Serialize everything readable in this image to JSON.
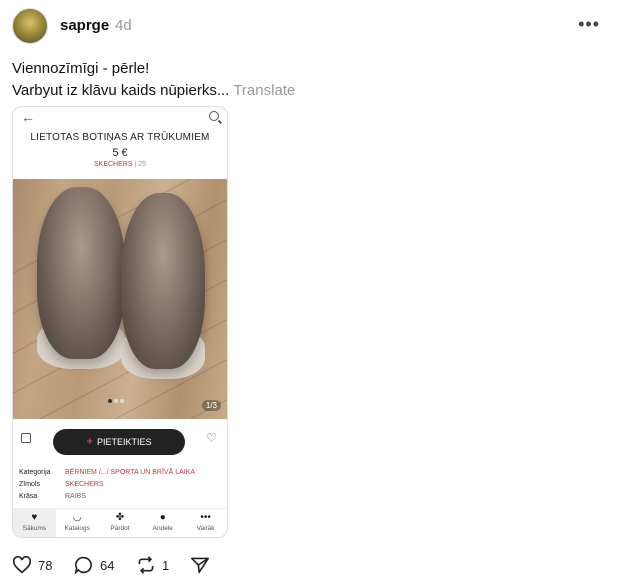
{
  "post": {
    "username": "saprge",
    "time": "4d",
    "more": "•••",
    "line1": "Viennozīmīgi - pērle!",
    "line2": "Varbyut iz klāvu kaids nūpierks...",
    "translate": "Translate"
  },
  "listing": {
    "back_icon": "←",
    "title": "LIETOTAS BOTIŅAS AR TRŪKUMIEM",
    "price": "5 €",
    "brand": "SKECHERS",
    "size": "25",
    "photo_counter": "1/3",
    "apply_label": "PIETEIKTIES",
    "attributes": [
      {
        "label": "Kategorija",
        "value": "BĒRNIEM /.../ SPORTA UN BRĪVĀ LAIKA"
      },
      {
        "label": "Zīmols",
        "value": "SKECHERS"
      },
      {
        "label": "Krāsa",
        "value": "RAIBS"
      }
    ],
    "nav": [
      {
        "label": "Sākums",
        "icon": "♥"
      },
      {
        "label": "Katalogs",
        "icon": "◡"
      },
      {
        "label": "Pārdot",
        "icon": "✤"
      },
      {
        "label": "Andele",
        "icon": "●"
      },
      {
        "label": "Vairāk",
        "icon": "•••"
      }
    ]
  },
  "actions": {
    "likes": "78",
    "comments": "64",
    "reposts": "1"
  },
  "colors": {
    "accent": "#c23a3a",
    "button": "#222222"
  }
}
